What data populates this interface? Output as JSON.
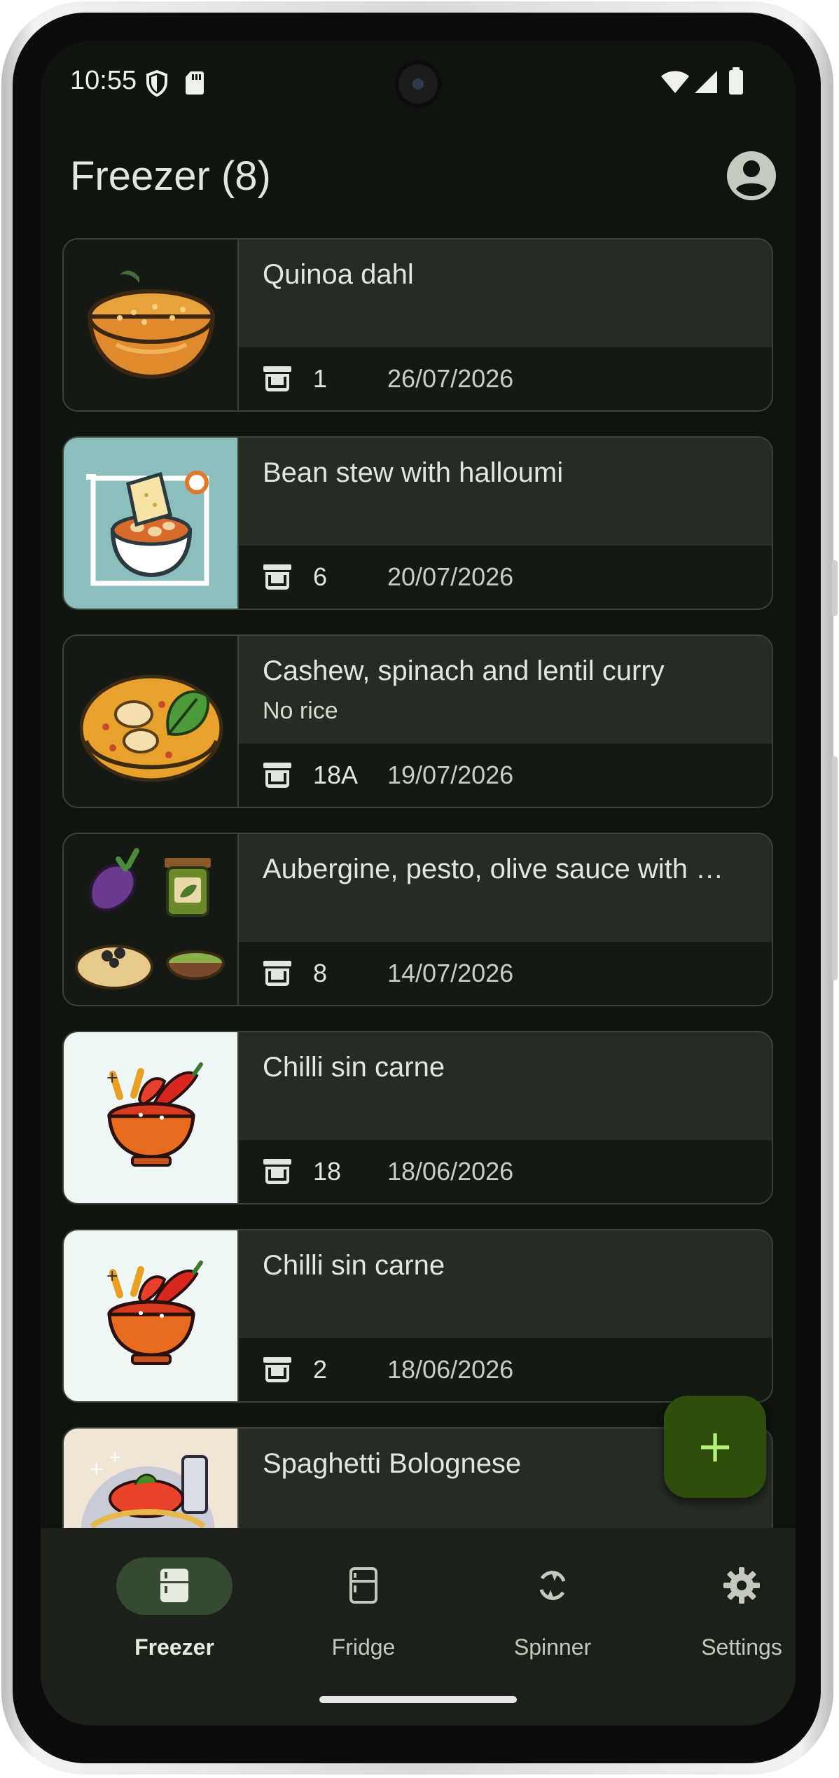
{
  "status_bar": {
    "time": "10:55"
  },
  "app_bar": {
    "title": "Freezer (8)"
  },
  "items": [
    {
      "title": "Quinoa dahl",
      "subtitle": "",
      "quantity": "1",
      "date": "26/07/2026"
    },
    {
      "title": "Bean stew with halloumi",
      "subtitle": "",
      "quantity": "6",
      "date": "20/07/2026"
    },
    {
      "title": "Cashew, spinach and lentil curry",
      "subtitle": "No rice",
      "quantity": "18A",
      "date": "19/07/2026"
    },
    {
      "title": "Aubergine, pesto, olive sauce with …",
      "subtitle": "",
      "quantity": "8",
      "date": "14/07/2026"
    },
    {
      "title": "Chilli sin carne",
      "subtitle": "",
      "quantity": "18",
      "date": "18/06/2026"
    },
    {
      "title": "Chilli sin carne",
      "subtitle": "",
      "quantity": "2",
      "date": "18/06/2026"
    },
    {
      "title": "Spaghetti Bolognese",
      "subtitle": "",
      "quantity": "",
      "date": ""
    }
  ],
  "fab": {
    "icon": "plus-icon"
  },
  "nav": [
    {
      "label": "Freezer",
      "icon": "freezer-icon",
      "active": true
    },
    {
      "label": "Fridge",
      "icon": "fridge-icon",
      "active": false
    },
    {
      "label": "Spinner",
      "icon": "refresh-icon",
      "active": false
    },
    {
      "label": "Settings",
      "icon": "gear-icon",
      "active": false
    }
  ],
  "colors": {
    "background": "#0f140e",
    "card_header": "#262b24",
    "fab": "#2f4e0e",
    "accent": "#b6f07a",
    "nav_active_pill": "#364a31"
  }
}
